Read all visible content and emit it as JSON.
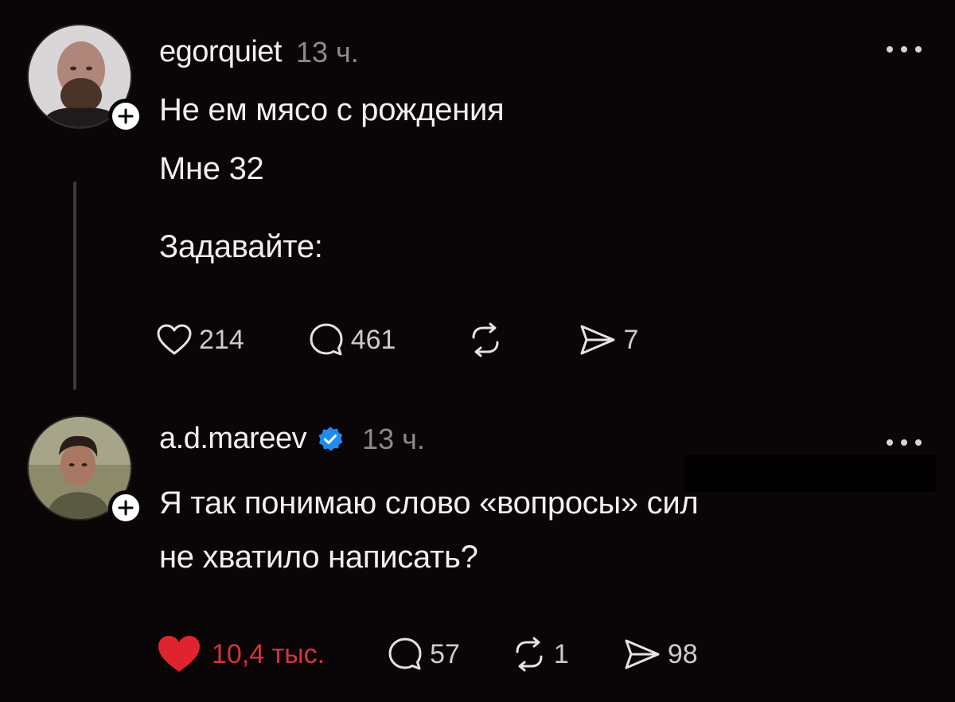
{
  "post1": {
    "username": "egorquiet",
    "time": "13 ч.",
    "lines": [
      "Не ем мясо с рождения",
      "Мне 32",
      "Задавайте:"
    ],
    "likes": "214",
    "replies": "461",
    "shares": "7"
  },
  "post2": {
    "username": "a.d.mareev",
    "time": "13 ч.",
    "lines": [
      "Я так понимаю слово «вопросы» сил",
      "не хватило написать?"
    ],
    "likes": "10,4 тыс.",
    "replies": "57",
    "reposts": "1",
    "shares": "98"
  }
}
